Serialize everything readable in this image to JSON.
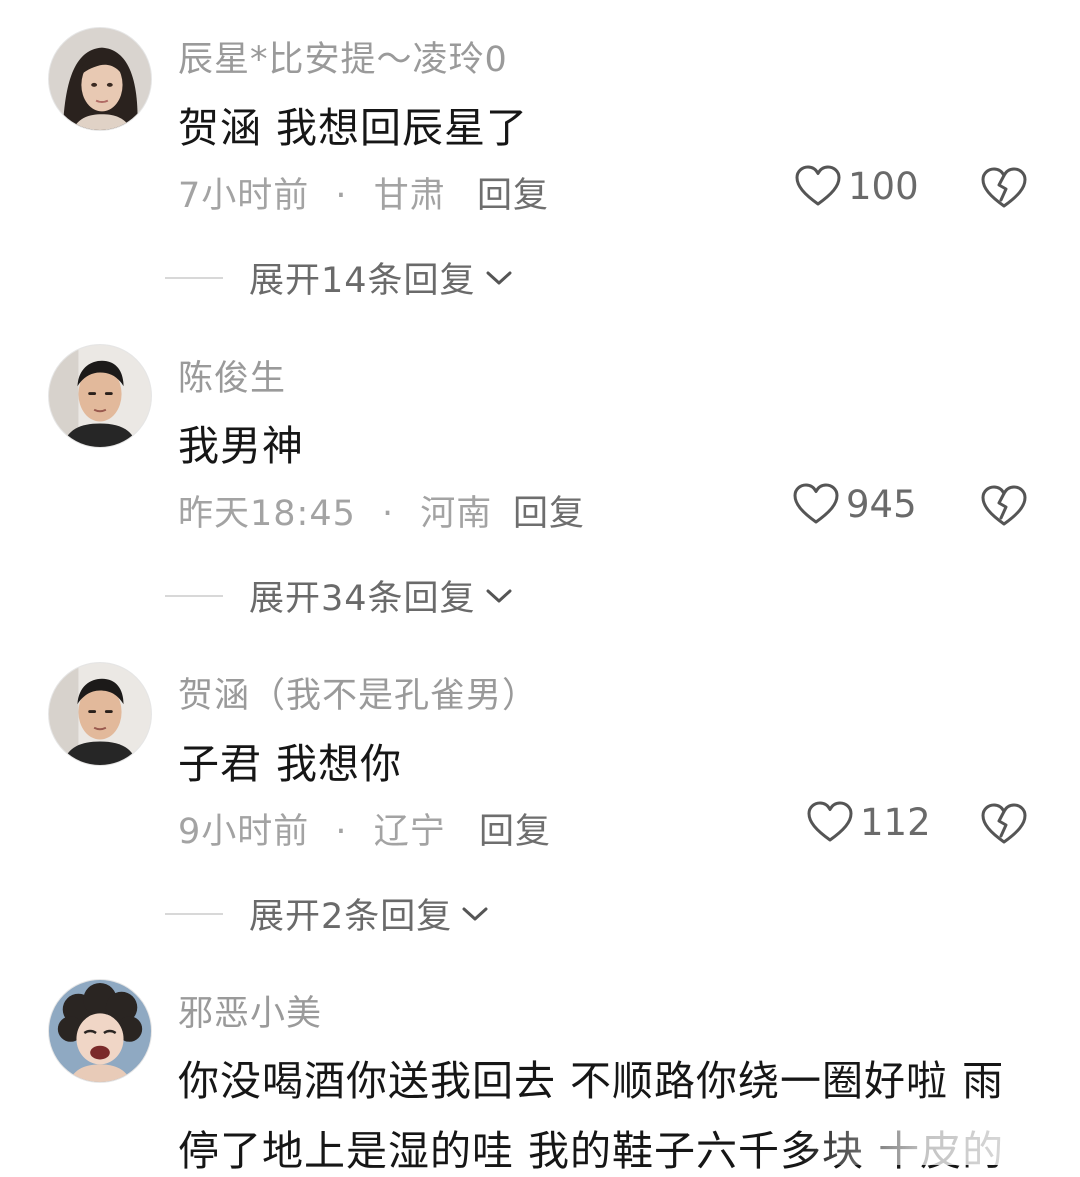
{
  "comments": [
    {
      "username": "辰星*比安提～凌玲0",
      "text": "贺涵 我想回辰星了",
      "time": "7小时前",
      "separator": "·",
      "location": "甘肃",
      "reply_label": "回复",
      "likes": "100",
      "expand_label": "展开14条回复",
      "avatar": "woman-avatar"
    },
    {
      "username": "陈俊生",
      "text": "我男神",
      "time": "昨天18:45",
      "separator": "·",
      "location": "河南",
      "reply_label": "回复",
      "likes": "945",
      "expand_label": "展开34条回复",
      "avatar": "man-avatar"
    },
    {
      "username": "贺涵（我不是孔雀男）",
      "text": "子君 我想你",
      "time": "9小时前",
      "separator": "·",
      "location": "辽宁",
      "reply_label": "回复",
      "likes": "112",
      "expand_label": "展开2条回复",
      "avatar": "man-avatar"
    },
    {
      "username": "邪恶小美",
      "text_line1": "你没喝酒你送我回去  不顺路你绕一圈好啦 雨",
      "text_line2": "停了地上是湿的哇 我的鞋子六千多块 十皮的",
      "avatar": "curly-hair-avatar"
    }
  ],
  "colors": {
    "text": "#161616",
    "muted": "#9a9a9a",
    "icon": "#555555"
  },
  "icons": {
    "like": "heart-outline-icon",
    "dislike": "broken-heart-icon",
    "expand": "chevron-down-icon"
  }
}
